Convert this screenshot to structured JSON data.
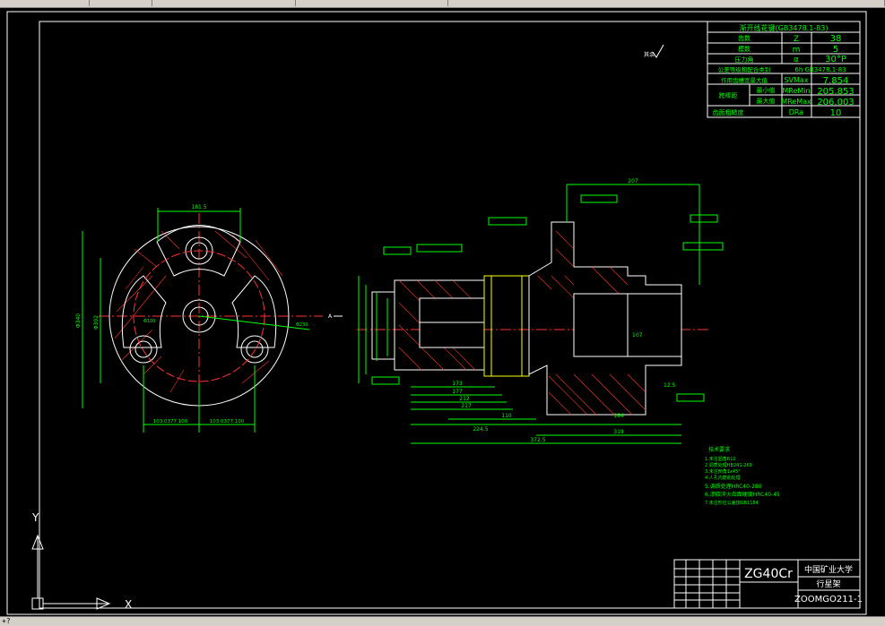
{
  "window": {
    "tabs": [
      "",
      "",
      "",
      "",
      ""
    ],
    "command_prompt": "+?"
  },
  "parameter_table": {
    "rows": [
      {
        "label": "渐开线花键(GB3478.1-83)",
        "sym": "",
        "val": ""
      },
      {
        "label": "齿数",
        "sym": "Z",
        "val": "38"
      },
      {
        "label": "模数",
        "sym": "m",
        "val": "5"
      },
      {
        "label": "压力角",
        "sym": "α",
        "val": "30°P"
      },
      {
        "label": "公差等级和配合类别",
        "sym": "",
        "val": "6h GB3478.1-83"
      },
      {
        "label": "作用齿槽宽最大值",
        "sym": "SVMax",
        "val": "7.854"
      },
      {
        "label": "最小值",
        "sym": "MReMin",
        "val": "205.853"
      },
      {
        "label": "最大值",
        "sym": "MReMax",
        "val": "206.003"
      },
      {
        "label": "齿面粗糙度",
        "sym": "DRa",
        "val": "10"
      }
    ],
    "group_label": "跨棒距"
  },
  "roughness_note": "其余",
  "dimensions": {
    "top_overall": "207",
    "left_width": "181.5",
    "left_half_a": "103.0377.100",
    "left_half_b": "103.0377.100",
    "left_dia_outer": "Φ340",
    "left_dia_inner": "Φ302",
    "d_173": "173",
    "d_177": "177",
    "d_212": "212",
    "d_217": "217",
    "d_224": "224.5",
    "d_110": "110",
    "d_184": "184",
    "d_319": "319",
    "d_372": "372.5",
    "d_107": "107",
    "d_125": "12.5"
  },
  "tech_requirements": {
    "title": "技术要求",
    "items": [
      "1.未注圆角R10",
      "2.调质处理HB241-269",
      "3.未注倒角1x45°",
      "4.人孔内磨削处理",
      "5.调质处理HRC40-280",
      "6.渗碳淬火齿面硬度HRC40-45",
      "7.未注形位公差按GB1184"
    ]
  },
  "title_block": {
    "material": "ZG40Cr",
    "school": "中国矿业大学",
    "part_name": "行星架",
    "drawing_no": "ZOOMGO211-1"
  },
  "ucs": {
    "x_label": "X",
    "y_label": "Y"
  }
}
